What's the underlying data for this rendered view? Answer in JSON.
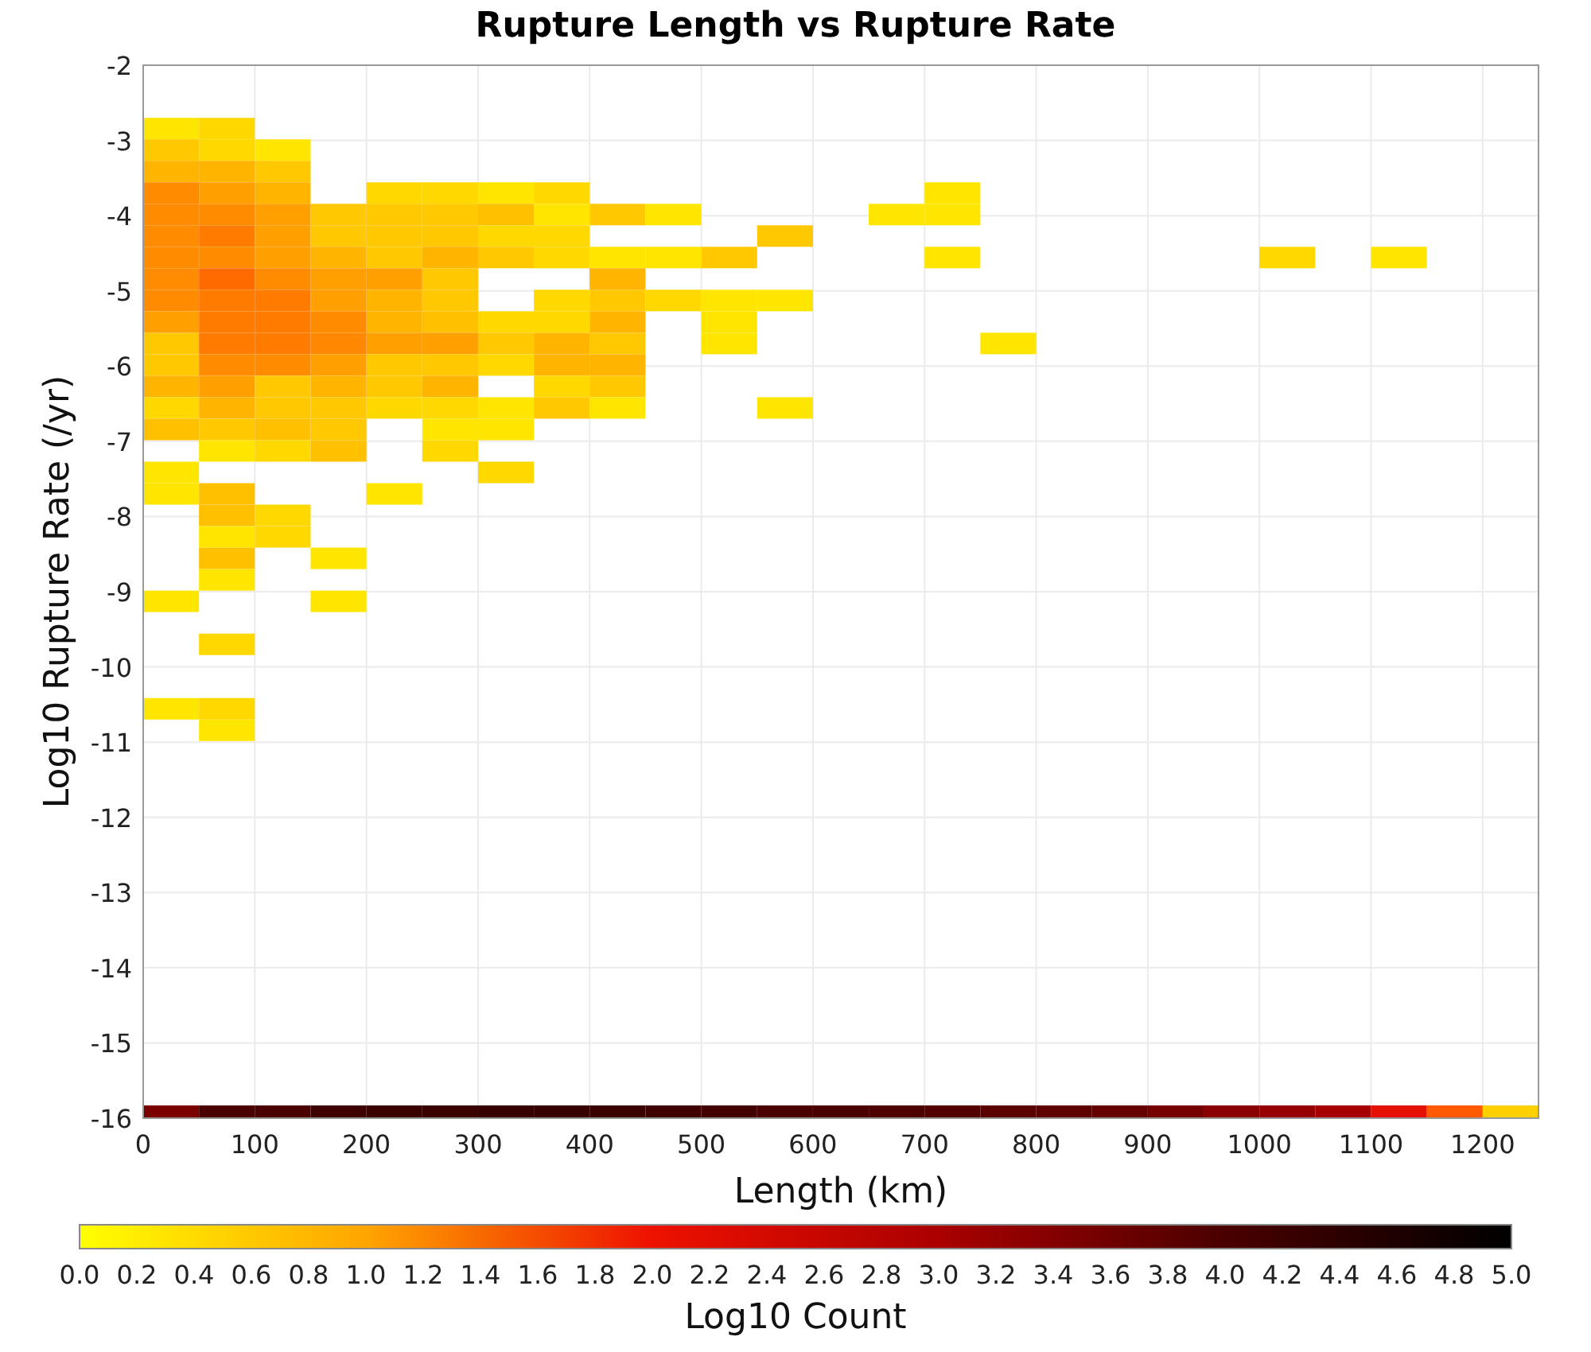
{
  "title": "Rupture Length vs Rupture Rate",
  "y_axis": {
    "title": "Log10 Rupture Rate (/yr)",
    "ticks": [
      "-2",
      "-3",
      "-4",
      "-5",
      "-6",
      "-7",
      "-8",
      "-9",
      "-10",
      "-11",
      "-12",
      "-13",
      "-14",
      "-15",
      "-16"
    ]
  },
  "x_axis": {
    "title": "Length (km)",
    "ticks": [
      "0",
      "100",
      "200",
      "300",
      "400",
      "500",
      "600",
      "700",
      "800",
      "900",
      "1000",
      "1100",
      "1200"
    ]
  },
  "heatmap": {
    "rows": [
      [
        {
          "color": "#ffe600"
        },
        {
          "color": "#ffd800"
        }
      ],
      [
        {
          "color": "#ffc800"
        },
        {
          "color": "#ffd800"
        },
        {
          "color": "#ffe600"
        }
      ],
      [
        {
          "color": "#ffb400"
        },
        {
          "color": "#ffb400"
        },
        {
          "color": "#ffc800"
        }
      ],
      [
        {
          "color": "#ff8c00"
        },
        {
          "color": "#ffa000"
        },
        {
          "color": "#ffb400"
        },
        null,
        {
          "color": "#ffd800"
        },
        {
          "color": "#ffd800"
        },
        {
          "color": "#ffe600"
        },
        {
          "color": "#ffd800"
        },
        null,
        null,
        null,
        null,
        null,
        null,
        {
          "color": "#ffe600"
        }
      ],
      [
        {
          "color": "#ff8c00"
        },
        {
          "color": "#ff8c00"
        },
        {
          "color": "#ffa000"
        },
        {
          "color": "#ffc800"
        },
        {
          "color": "#ffc800"
        },
        {
          "color": "#ffc800"
        },
        {
          "color": "#ffc000"
        },
        {
          "color": "#ffe600"
        },
        {
          "color": "#ffc800"
        },
        {
          "color": "#ffe600"
        },
        null,
        null,
        null,
        {
          "color": "#ffe600"
        },
        {
          "color": "#ffe600"
        }
      ],
      [
        {
          "color": "#ff8c00"
        },
        {
          "color": "#ff7c00"
        },
        {
          "color": "#ffa000"
        },
        {
          "color": "#ffc800"
        },
        {
          "color": "#ffc800"
        },
        {
          "color": "#ffc800"
        },
        {
          "color": "#ffd800"
        },
        {
          "color": "#ffd800"
        },
        null,
        null,
        null,
        {
          "color": "#ffc800"
        }
      ],
      [
        {
          "color": "#ff8c00"
        },
        {
          "color": "#ff8c00"
        },
        {
          "color": "#ffa000"
        },
        {
          "color": "#ffb400"
        },
        {
          "color": "#ffc800"
        },
        {
          "color": "#ffb400"
        },
        {
          "color": "#ffc800"
        },
        {
          "color": "#ffd800"
        },
        {
          "color": "#ffe600"
        },
        {
          "color": "#ffe600"
        },
        {
          "color": "#ffc800"
        },
        null,
        null,
        null,
        {
          "color": "#ffe600"
        },
        null,
        null,
        null,
        null,
        null,
        {
          "color": "#ffd800"
        },
        null,
        {
          "color": "#ffe600"
        }
      ],
      [
        {
          "color": "#ff8c00"
        },
        {
          "color": "#ff6a00"
        },
        {
          "color": "#ff8c00"
        },
        {
          "color": "#ffa000"
        },
        {
          "color": "#ffa000"
        },
        {
          "color": "#ffc800"
        },
        null,
        null,
        {
          "color": "#ffb400"
        }
      ],
      [
        {
          "color": "#ff8c00"
        },
        {
          "color": "#ff7c00"
        },
        {
          "color": "#ff7c00"
        },
        {
          "color": "#ffa000"
        },
        {
          "color": "#ffb400"
        },
        {
          "color": "#ffc800"
        },
        null,
        {
          "color": "#ffd800"
        },
        {
          "color": "#ffc800"
        },
        {
          "color": "#ffd800"
        },
        {
          "color": "#ffe600"
        },
        {
          "color": "#ffe600"
        }
      ],
      [
        {
          "color": "#ffa000"
        },
        {
          "color": "#ff7c00"
        },
        {
          "color": "#ff7c00"
        },
        {
          "color": "#ff8c00"
        },
        {
          "color": "#ffb400"
        },
        {
          "color": "#ffc000"
        },
        {
          "color": "#ffd800"
        },
        {
          "color": "#ffd800"
        },
        {
          "color": "#ffb400"
        },
        null,
        {
          "color": "#ffe600"
        }
      ],
      [
        {
          "color": "#ffc800"
        },
        {
          "color": "#ff7c00"
        },
        {
          "color": "#ff7c00"
        },
        {
          "color": "#ff8800"
        },
        {
          "color": "#ffa000"
        },
        {
          "color": "#ffa000"
        },
        {
          "color": "#ffc800"
        },
        {
          "color": "#ffb400"
        },
        {
          "color": "#ffc800"
        },
        null,
        {
          "color": "#ffe600"
        },
        null,
        null,
        null,
        null,
        {
          "color": "#ffe600"
        }
      ],
      [
        {
          "color": "#ffc800"
        },
        {
          "color": "#ff8c00"
        },
        {
          "color": "#ff8c00"
        },
        {
          "color": "#ffa000"
        },
        {
          "color": "#ffc800"
        },
        {
          "color": "#ffc800"
        },
        {
          "color": "#ffd800"
        },
        {
          "color": "#ffb400"
        },
        {
          "color": "#ffb400"
        }
      ],
      [
        {
          "color": "#ffb400"
        },
        {
          "color": "#ffa000"
        },
        {
          "color": "#ffc800"
        },
        {
          "color": "#ffb400"
        },
        {
          "color": "#ffc800"
        },
        {
          "color": "#ffb400"
        },
        null,
        {
          "color": "#ffd800"
        },
        {
          "color": "#ffc800"
        }
      ],
      [
        {
          "color": "#ffd800"
        },
        {
          "color": "#ffb400"
        },
        {
          "color": "#ffc800"
        },
        {
          "color": "#ffc800"
        },
        {
          "color": "#ffd800"
        },
        {
          "color": "#ffd800"
        },
        {
          "color": "#ffe600"
        },
        {
          "color": "#ffc800"
        },
        {
          "color": "#ffe600"
        },
        null,
        null,
        {
          "color": "#ffe600"
        }
      ],
      [
        {
          "color": "#ffc000"
        },
        {
          "color": "#ffc800"
        },
        {
          "color": "#ffc000"
        },
        {
          "color": "#ffc800"
        },
        null,
        {
          "color": "#ffe600"
        },
        {
          "color": "#ffe600"
        }
      ],
      [
        null,
        {
          "color": "#ffe600"
        },
        {
          "color": "#ffd800"
        },
        {
          "color": "#ffc000"
        },
        null,
        {
          "color": "#ffd800"
        }
      ],
      [
        {
          "color": "#ffe600"
        },
        null,
        null,
        null,
        null,
        null,
        {
          "color": "#ffd800"
        }
      ],
      [
        {
          "color": "#ffe600"
        },
        {
          "color": "#ffc000"
        },
        null,
        null,
        {
          "color": "#ffe600"
        }
      ],
      [
        null,
        {
          "color": "#ffc000"
        },
        {
          "color": "#ffd800"
        }
      ],
      [
        null,
        {
          "color": "#ffe600"
        },
        {
          "color": "#ffd800"
        }
      ],
      [
        null,
        {
          "color": "#ffc000"
        },
        null,
        {
          "color": "#ffe600"
        }
      ],
      [
        null,
        {
          "color": "#ffe600"
        }
      ],
      [
        {
          "color": "#ffe600"
        },
        null,
        null,
        {
          "color": "#ffe600"
        }
      ],
      null,
      [
        null,
        {
          "color": "#ffd800"
        }
      ],
      null,
      null,
      [
        {
          "color": "#ffe600"
        },
        {
          "color": "#ffd800"
        }
      ],
      [
        null,
        {
          "color": "#ffe600"
        }
      ]
    ],
    "baseline_row": [
      {
        "color": "#7a0000"
      },
      {
        "color": "#4a0000"
      },
      {
        "color": "#4a0000"
      },
      {
        "color": "#3e0000"
      },
      {
        "color": "#3a0000"
      },
      {
        "color": "#3a0000"
      },
      {
        "color": "#360000"
      },
      {
        "color": "#360000"
      },
      {
        "color": "#3a0000"
      },
      {
        "color": "#3e0000"
      },
      {
        "color": "#420000"
      },
      {
        "color": "#4a0000"
      },
      {
        "color": "#4a0000"
      },
      {
        "color": "#4e0000"
      },
      {
        "color": "#520000"
      },
      {
        "color": "#5a0000"
      },
      {
        "color": "#5e0000"
      },
      {
        "color": "#660000"
      },
      {
        "color": "#760000"
      },
      {
        "color": "#8a0000"
      },
      {
        "color": "#960000"
      },
      {
        "color": "#a60000"
      },
      {
        "color": "#e41000"
      },
      {
        "color": "#ff5a00"
      },
      {
        "color": "#ffd000"
      }
    ]
  },
  "colorbar": {
    "title": "Log10 Count",
    "ticks": [
      "0.0",
      "0.2",
      "0.4",
      "0.6",
      "0.8",
      "1.0",
      "1.2",
      "1.4",
      "1.6",
      "1.8",
      "2.0",
      "2.2",
      "2.4",
      "2.6",
      "2.8",
      "3.0",
      "3.2",
      "3.4",
      "3.6",
      "3.8",
      "4.0",
      "4.2",
      "4.4",
      "4.6",
      "4.8",
      "5.0"
    ]
  }
}
